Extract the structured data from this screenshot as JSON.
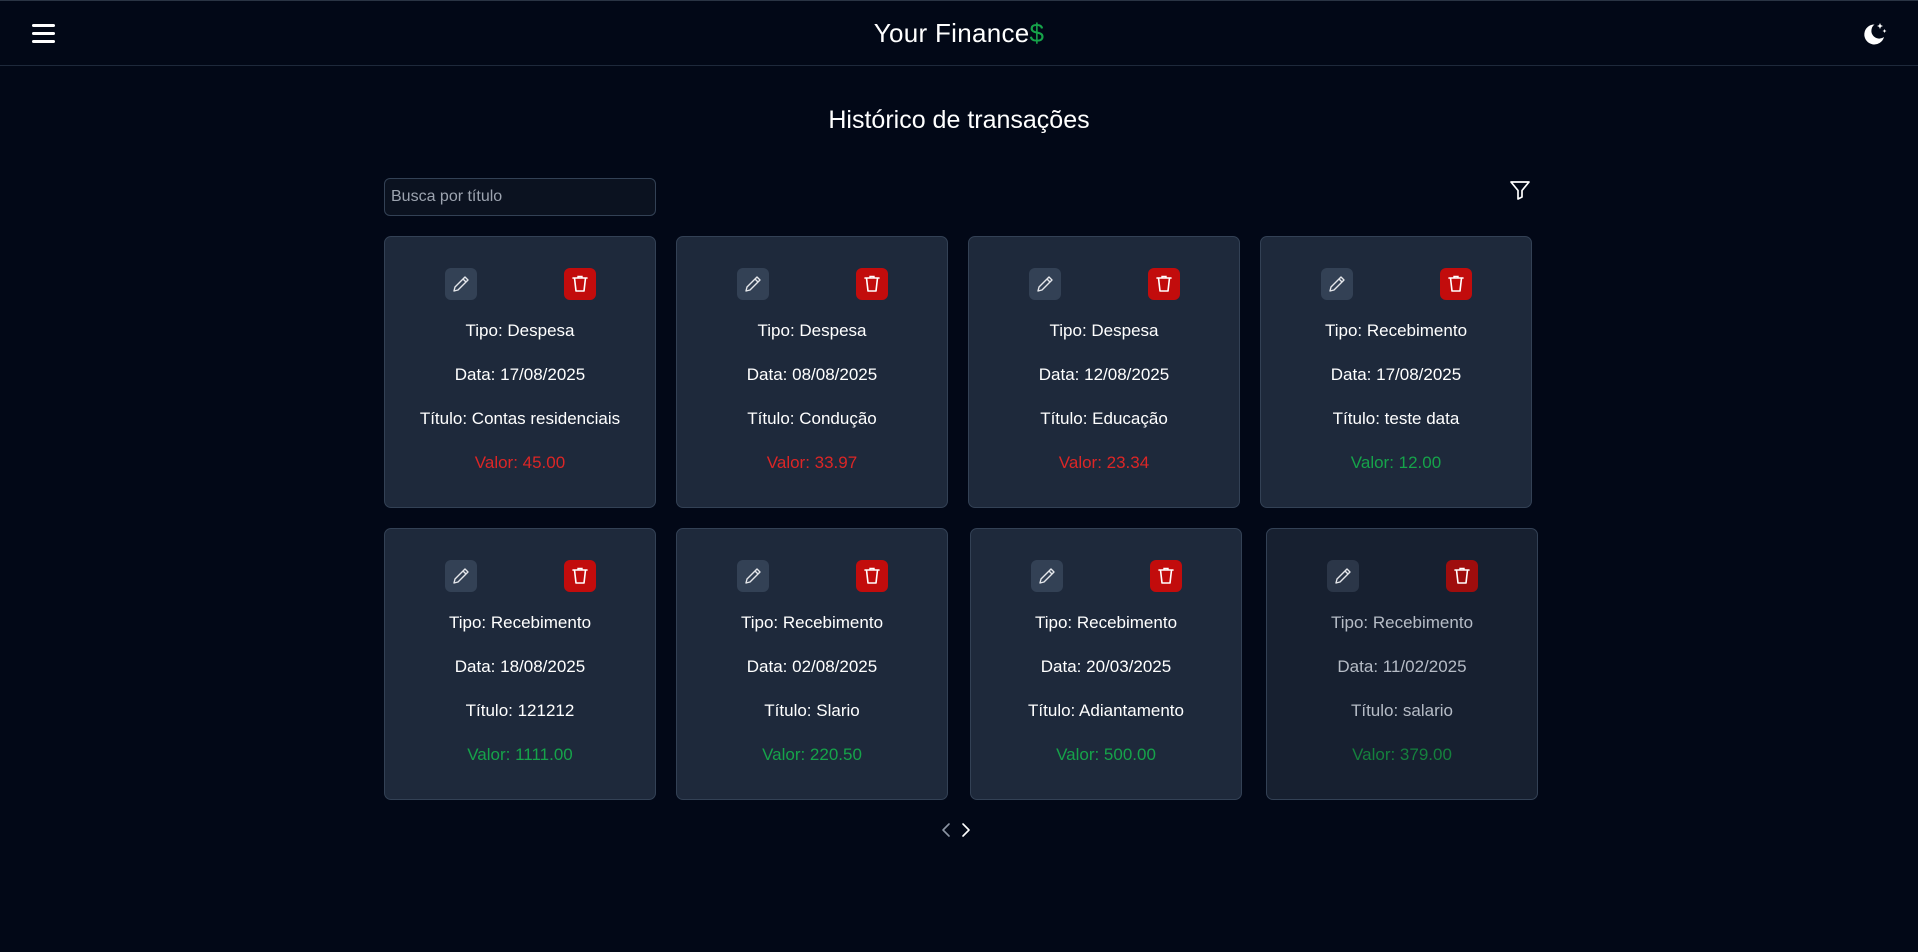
{
  "header": {
    "title_main": "Your Finance",
    "title_symbol": "$",
    "menu_icon": "hamburger-menu-icon",
    "theme_icon": "moon-stars-icon"
  },
  "page": {
    "title": "Histórico de transações"
  },
  "search": {
    "placeholder": "Busca por título",
    "value": ""
  },
  "filter": {
    "icon": "filter-funnel-icon"
  },
  "transactions": [
    {
      "tipo": "Tipo: Despesa",
      "data": "Data: 17/08/2025",
      "titulo": "Título: Contas residenciais",
      "valor": "Valor: 45.00",
      "kind": "despesa"
    },
    {
      "tipo": "Tipo: Despesa",
      "data": "Data: 08/08/2025",
      "titulo": "Título: Condução",
      "valor": "Valor: 33.97",
      "kind": "despesa"
    },
    {
      "tipo": "Tipo: Despesa",
      "data": "Data: 12/08/2025",
      "titulo": "Título: Educação",
      "valor": "Valor: 23.34",
      "kind": "despesa"
    },
    {
      "tipo": "Tipo: Recebimento",
      "data": "Data: 17/08/2025",
      "titulo": "Título: teste data",
      "valor": "Valor: 12.00",
      "kind": "recebimento"
    },
    {
      "tipo": "Tipo: Recebimento",
      "data": "Data: 18/08/2025",
      "titulo": "Título: 121212",
      "valor": "Valor: 1111.00",
      "kind": "recebimento"
    },
    {
      "tipo": "Tipo: Recebimento",
      "data": "Data: 02/08/2025",
      "titulo": "Título: Slario",
      "valor": "Valor: 220.50",
      "kind": "recebimento"
    },
    {
      "tipo": "Tipo: Recebimento",
      "data": "Data: 20/03/2025",
      "titulo": "Título: Adiantamento",
      "valor": "Valor: 500.00",
      "kind": "recebimento"
    },
    {
      "tipo": "Tipo: Recebimento",
      "data": "Data: 11/02/2025",
      "titulo": "Título: salario",
      "valor": "Valor: 379.00",
      "kind": "recebimento"
    }
  ],
  "card_icons": {
    "edit": "pencil-icon",
    "delete": "trash-icon"
  },
  "pagination": {
    "prev_icon": "chevron-left-icon",
    "next_icon": "chevron-right-icon"
  },
  "colors": {
    "background": "#020817",
    "card": "#1e293b",
    "expense": "#dc2626",
    "income": "#16a34a",
    "delete_button": "#c20c0c",
    "edit_button": "#334155"
  }
}
